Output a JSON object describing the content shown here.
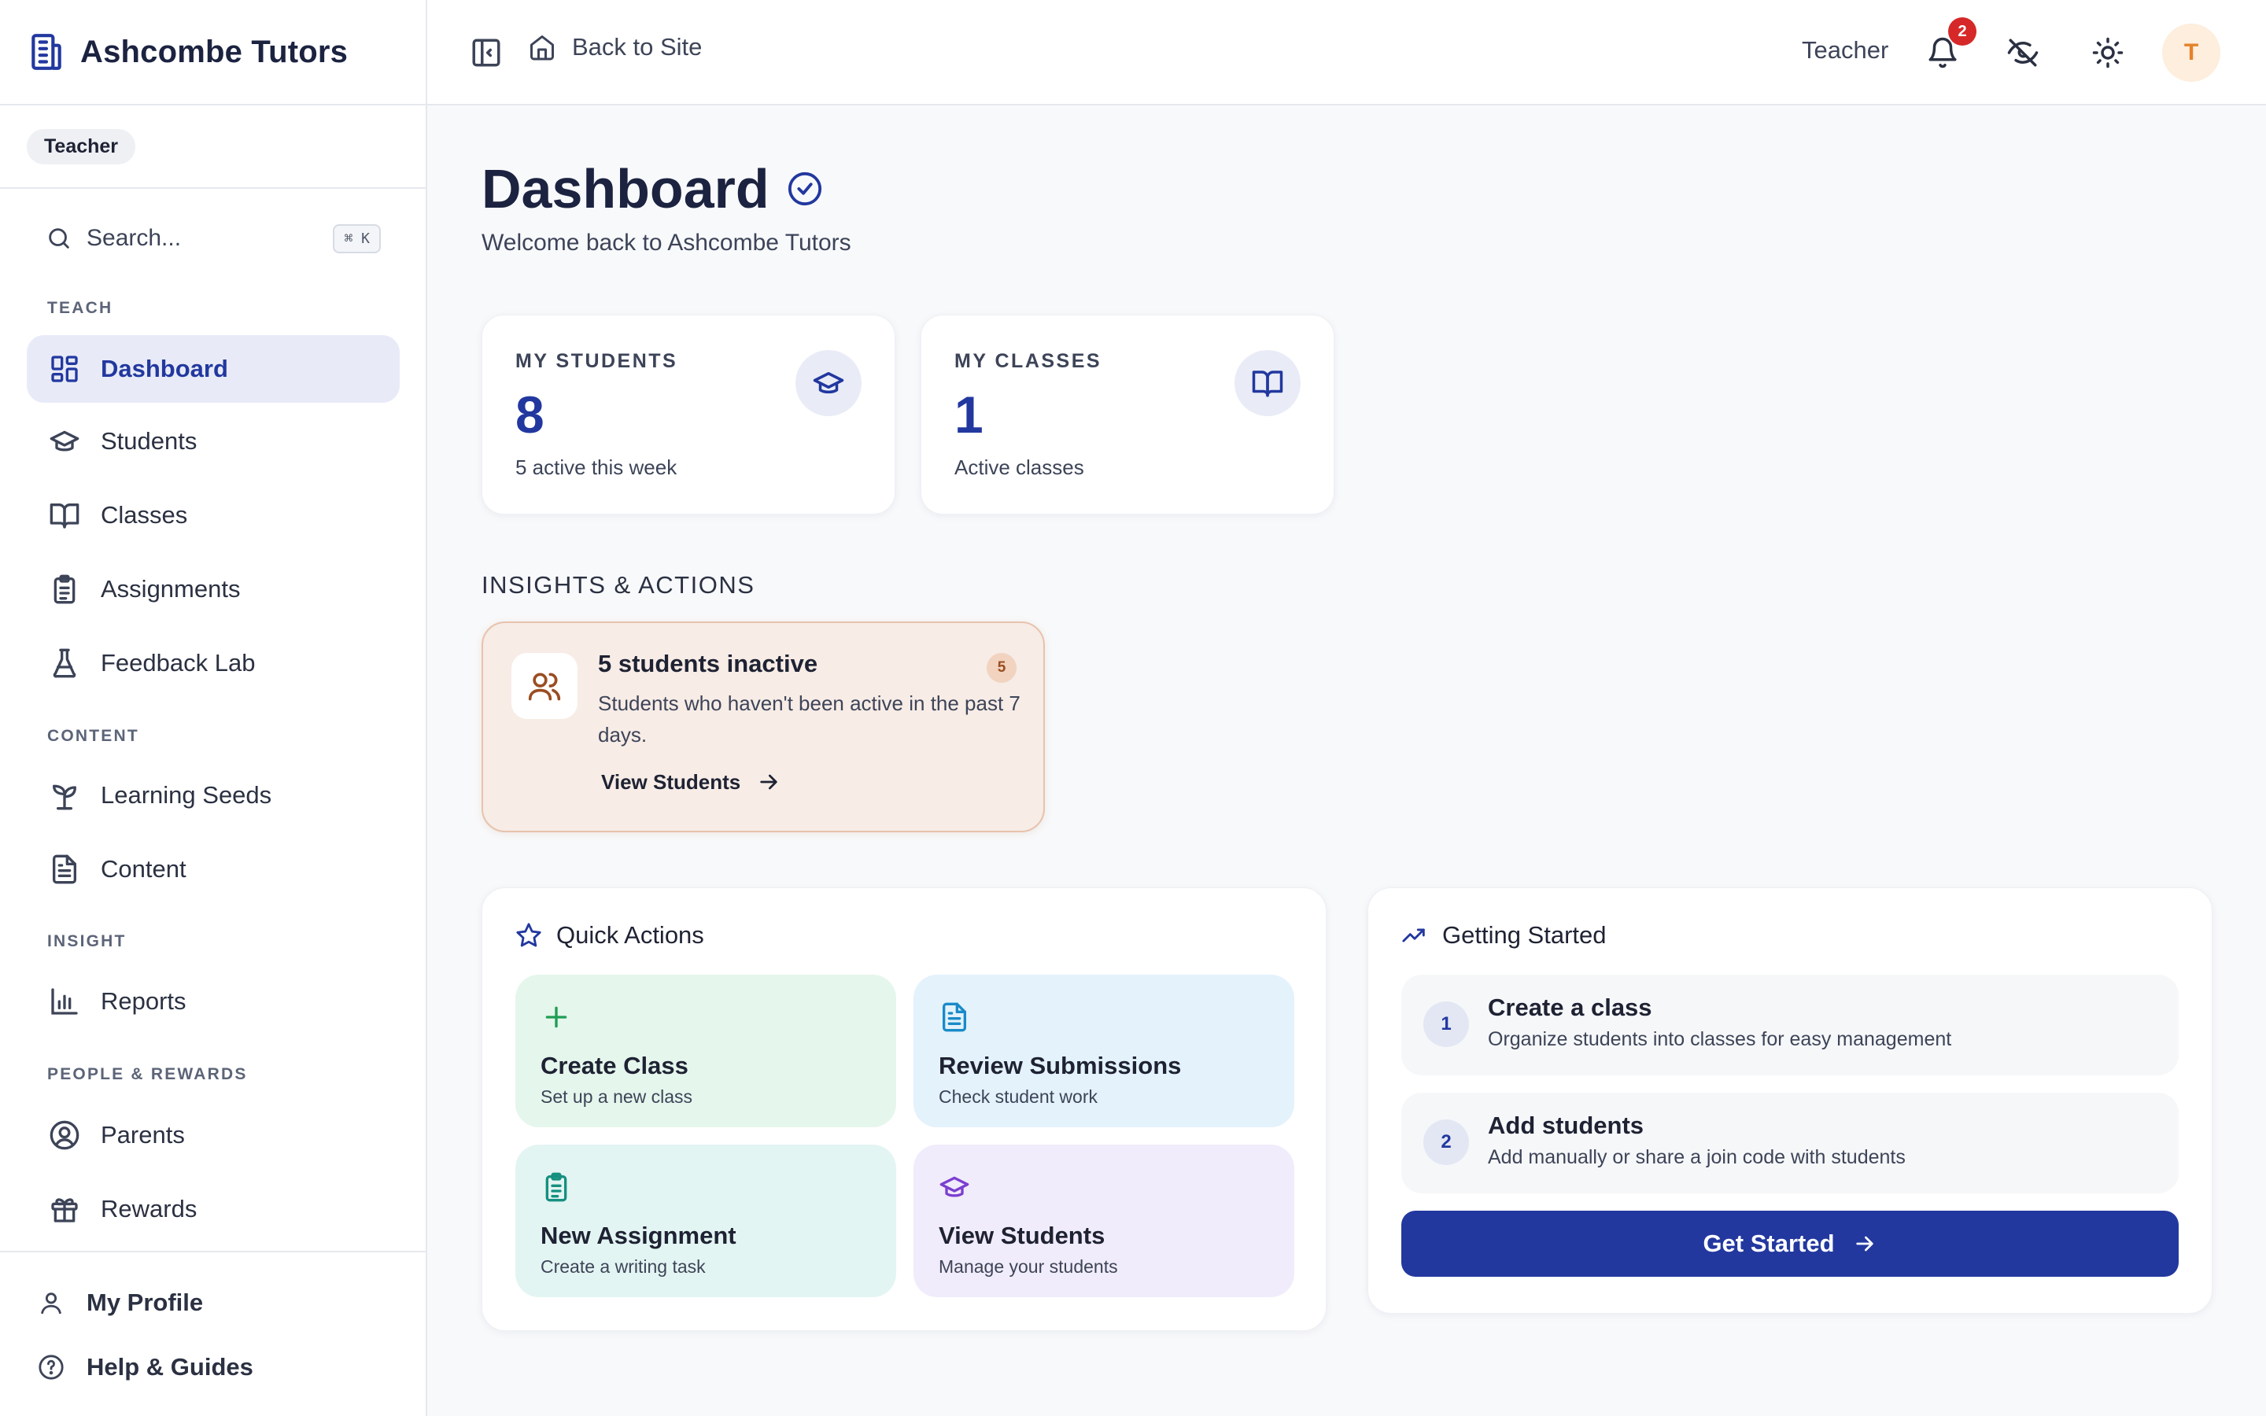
{
  "brand": {
    "name": "Ashcombe Tutors"
  },
  "role_pill": "Teacher",
  "search": {
    "placeholder": "Search...",
    "shortcut": "⌘ K"
  },
  "nav": {
    "sections": {
      "teach": "TEACH",
      "content": "CONTENT",
      "insight": "INSIGHT",
      "people": "PEOPLE & REWARDS"
    },
    "items": {
      "dashboard": "Dashboard",
      "students": "Students",
      "classes": "Classes",
      "assignments": "Assignments",
      "feedback_lab": "Feedback Lab",
      "learning_seeds": "Learning Seeds",
      "content": "Content",
      "reports": "Reports",
      "parents": "Parents",
      "rewards": "Rewards"
    },
    "footer": {
      "profile": "My Profile",
      "help": "Help & Guides"
    }
  },
  "topbar": {
    "back_label": "Back to Site",
    "role": "Teacher",
    "notification_count": "2",
    "avatar_initial": "T"
  },
  "page": {
    "title": "Dashboard",
    "subtitle": "Welcome back to Ashcombe Tutors"
  },
  "stats": {
    "students": {
      "title": "MY STUDENTS",
      "value": "8",
      "sub": "5 active this week"
    },
    "classes": {
      "title": "MY CLASSES",
      "value": "1",
      "sub": "Active classes"
    }
  },
  "insights": {
    "heading": "INSIGHTS & ACTIONS",
    "card": {
      "title": "5 students inactive",
      "count": "5",
      "description": "Students who haven't been active in the past 7 days.",
      "link": "View Students"
    }
  },
  "quick_actions": {
    "heading": "Quick Actions",
    "tiles": {
      "create_class": {
        "title": "Create Class",
        "sub": "Set up a new class"
      },
      "review": {
        "title": "Review Submissions",
        "sub": "Check student work"
      },
      "assignment": {
        "title": "New Assignment",
        "sub": "Create a writing task"
      },
      "view_students": {
        "title": "View Students",
        "sub": "Manage your students"
      }
    }
  },
  "getting_started": {
    "heading": "Getting Started",
    "steps": [
      {
        "num": "1",
        "title": "Create a class",
        "sub": "Organize students into classes for easy management"
      },
      {
        "num": "2",
        "title": "Add students",
        "sub": "Add manually or share a join code with students"
      }
    ],
    "button": "Get Started"
  },
  "colors": {
    "primary": "#22389f",
    "tile_green": "#e5f6ec",
    "tile_blue": "#e3f2fb",
    "tile_teal": "#e3f5f2",
    "tile_purple": "#f1ecfb",
    "insight_bg": "#f7ece6",
    "badge_red": "#d62828"
  }
}
